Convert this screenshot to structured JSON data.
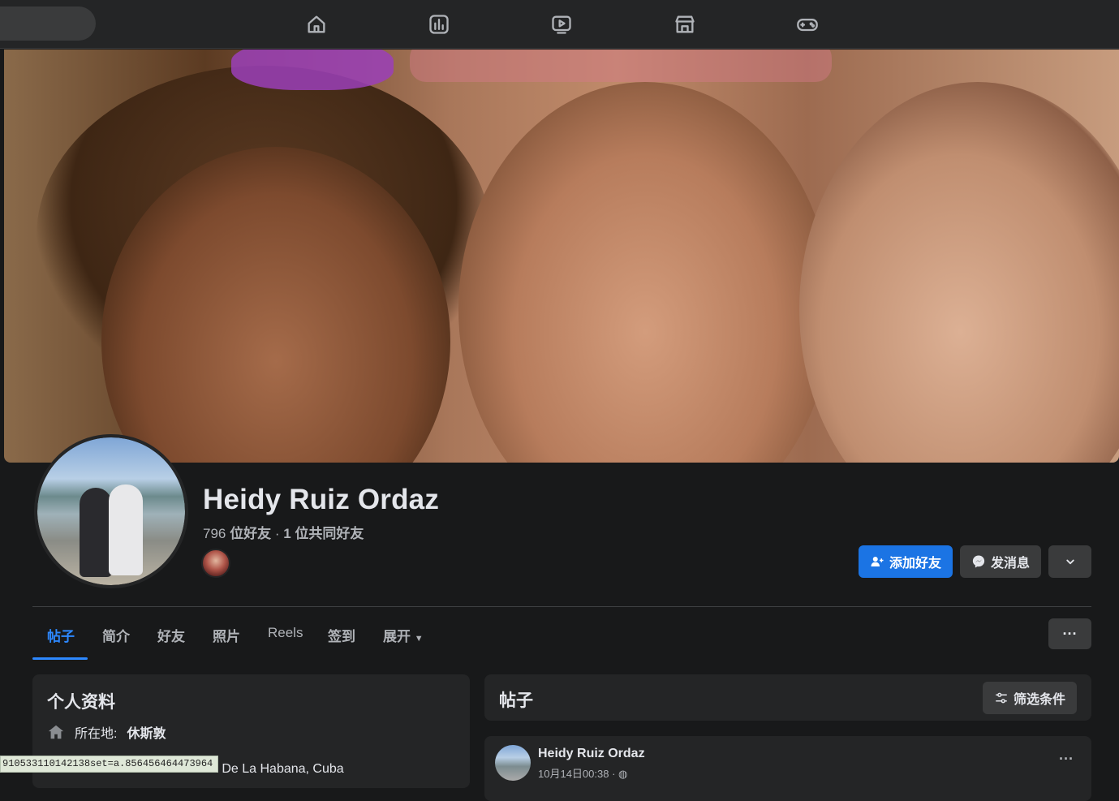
{
  "profile": {
    "name": "Heidy Ruiz Ordaz",
    "friends_count": "796",
    "friends_suffix": "位好友",
    "mutual": "1 位共同好友"
  },
  "actions": {
    "add_friend": "添加好友",
    "message": "发消息"
  },
  "tabs": [
    "帖子",
    "简介",
    "好友",
    "照片",
    "Reels",
    "签到",
    "展开"
  ],
  "tabs_more": "···",
  "intro": {
    "title": "个人资料",
    "location_label": "所在地:",
    "location_value": "休斯敦",
    "hometown_partial": "d De La Habana, Cuba"
  },
  "posts": {
    "title": "帖子",
    "filter_label": "筛选条件",
    "first_post": {
      "author": "Heidy Ruiz Ordaz",
      "time": "10月14日00:38 · ",
      "more": "···"
    }
  },
  "status_bar": {
    "url": "910533110142138set=a.856456464473964"
  },
  "colors": {
    "accent": "#1b74e4",
    "active_tab": "#2d88ff",
    "surface": "#242526",
    "background": "#18191a"
  },
  "icons": {
    "nav": [
      "home-icon",
      "dashboard-icon",
      "video-icon",
      "marketplace-icon",
      "gaming-icon"
    ]
  }
}
